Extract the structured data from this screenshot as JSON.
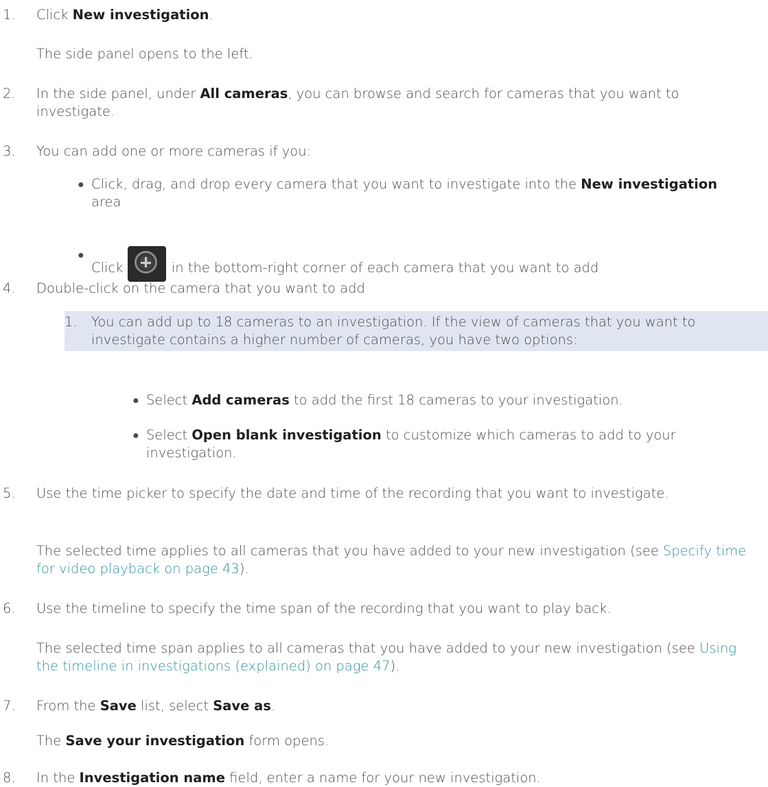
{
  "steps": {
    "s1": {
      "num": "1.",
      "pre": "Click ",
      "b1": "New investigation",
      "post": ".",
      "para": "The side panel opens to the left."
    },
    "s2": {
      "num": "2.",
      "pre": "In the side panel, under ",
      "b1": "All cameras",
      "post": ", you can browse and search for cameras that you want to investigate."
    },
    "s3": {
      "num": "3.",
      "text": "You can add one or more cameras if you:"
    },
    "b1": {
      "pre": "Click, drag, and drop every camera that you want to investigate into the ",
      "b1": "New investigation",
      "post": " area"
    },
    "b2": {
      "pre": "Click ",
      "post": " in the bottom-right corner of each camera that you want to add"
    },
    "s4": {
      "num": "4.",
      "text": "Double-click on the camera that you want to add"
    },
    "note": {
      "num": "1.",
      "text": "You can add up to 18 cameras to an investigation. If the view of cameras that you want to investigate contains a higher number of cameras, you have two options:"
    },
    "nb1": {
      "pre": "Select ",
      "b1": "Add cameras",
      "post": " to add the first 18 cameras to your investigation."
    },
    "nb2": {
      "pre": "Select ",
      "b1": "Open blank investigation",
      "post": " to customize which cameras to add to your investigation."
    },
    "s5": {
      "num": "5.",
      "text": "Use the time picker to specify the date and time of the recording that you want to investigate.",
      "para_pre": "The selected time applies to all cameras that you have added to your new investigation (see ",
      "link": "Specify time for video playback on page 43",
      "para_post": ")."
    },
    "s6": {
      "num": "6.",
      "text": "Use the timeline to specify the time span of the recording that you want to play back.",
      "para_pre": "The selected time span applies to all cameras that you have added to your new investigation (see ",
      "link": "Using the timeline in investigations (explained) on page 47",
      "para_post": ")."
    },
    "s7": {
      "num": "7.",
      "pre": "From the ",
      "b1": "Save",
      "mid": " list, select ",
      "b2": "Save as",
      "post": ".",
      "para_pre": "The ",
      "para_b": "Save your investigation",
      "para_post": " form opens."
    },
    "s8": {
      "num": "8.",
      "pre": "In the ",
      "b1": "Investigation name",
      "post": " field, enter a name for your new investigation."
    }
  },
  "icons": {
    "add": "plus-circle-icon"
  },
  "colors": {
    "link": "#2f8f9a",
    "note_bg": "#dfe6f2"
  }
}
